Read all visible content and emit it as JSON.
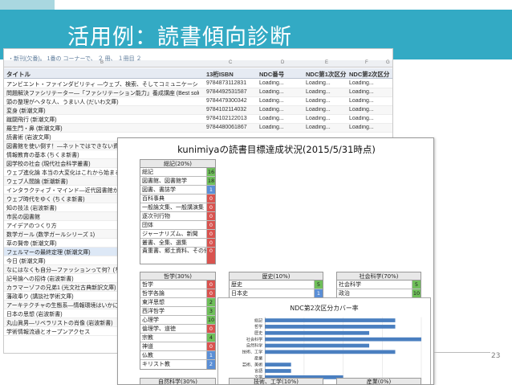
{
  "slide": {
    "title": "活用例：読書傾向診断",
    "page_number": "23"
  },
  "sheet": {
    "formula_text": "・新刊(欠番)。 1番の コーナーで、 ２ 冊、 １冊目 ２",
    "col_letters": [
      "B",
      "C",
      "D",
      "E",
      "F",
      "G"
    ],
    "headers": {
      "title": "タイトル",
      "isbn": "13桁ISBN",
      "ndc": "NDC番号",
      "ndc2a": "NDC第1次区分",
      "ndc2b": "NDC第2次区分"
    },
    "rows": [
      {
        "title": "アンビエント・ファインダビリティ ―ウェブ、検索、そしてコミュニケーションをめぐる旅",
        "isbn": "9784873112831",
        "ndc": "Loading...",
        "f": "Loading...",
        "g": "Loading..."
      },
      {
        "title": "問題解決ファシリテーター―「ファシリテーション能力」養成講座 (Best solution)",
        "isbn": "9784492531587",
        "ndc": "Loading...",
        "f": "Loading...",
        "g": "Loading..."
      },
      {
        "title": "頭の整理がヘタな人、うまい人 (だいわ文庫)",
        "isbn": "9784479300342",
        "ndc": "Loading...",
        "f": "Loading...",
        "g": "Loading..."
      },
      {
        "title": "変身 (新潮文庫)",
        "isbn": "9784102114032",
        "ndc": "Loading...",
        "f": "Loading...",
        "g": "Loading..."
      },
      {
        "title": "蹴闘飛行 (新潮文庫)",
        "isbn": "9784102122013",
        "ndc": "Loading...",
        "f": "Loading...",
        "g": "Loading..."
      },
      {
        "title": "羅生門・鼻 (新潮文庫)",
        "isbn": "9784480061867",
        "ndc": "Loading...",
        "f": "Loading...",
        "g": "Loading..."
      },
      {
        "title": "読書術 (岩波文庫)",
        "isbn": "",
        "ndc": "",
        "f": "",
        "g": ""
      },
      {
        "title": "図書館を使い倒す！―ネットではできない資料",
        "isbn": "",
        "ndc": "",
        "f": "",
        "g": ""
      },
      {
        "title": "情報教育の基本 (ちくま新書)",
        "isbn": "",
        "ndc": "",
        "f": "",
        "g": ""
      },
      {
        "title": "図学校の社会 (現代社会科学叢書)",
        "isbn": "",
        "ndc": "",
        "f": "",
        "g": ""
      },
      {
        "title": "ウェブ進化論 本当の大変化はこれから始まる",
        "isbn": "",
        "ndc": "",
        "f": "",
        "g": ""
      },
      {
        "title": "ウェブ人間論 (新潮新書)",
        "isbn": "",
        "ndc": "",
        "f": "",
        "g": ""
      },
      {
        "title": "インタラクティブ・マインド―近代図書館から",
        "isbn": "",
        "ndc": "",
        "f": "",
        "g": ""
      },
      {
        "title": "ウェブ時代をゆく (ちくま新書)",
        "isbn": "",
        "ndc": "",
        "f": "",
        "g": ""
      },
      {
        "title": "知の技法 (岩波新書)",
        "isbn": "",
        "ndc": "",
        "f": "",
        "g": ""
      },
      {
        "title": "市民の図書館",
        "isbn": "",
        "ndc": "",
        "f": "",
        "g": ""
      },
      {
        "title": "アイデアのつくり方",
        "isbn": "",
        "ndc": "",
        "f": "",
        "g": ""
      },
      {
        "title": "数学ガール (数学ガールシリーズ 1)",
        "isbn": "",
        "ndc": "",
        "f": "",
        "g": ""
      },
      {
        "title": "草の賢帝 (新潮文庫)",
        "isbn": "",
        "ndc": "",
        "f": "",
        "g": ""
      },
      {
        "title": "フェルマーの最終定理 (新潮文庫)",
        "isbn": "",
        "ndc": "",
        "f": "",
        "g": ""
      },
      {
        "title": "今日 (新潮文庫)",
        "isbn": "",
        "ndc": "",
        "f": "",
        "g": ""
      },
      {
        "title": "なにはなくも自分―ファッションって何？(ちくま",
        "isbn": "",
        "ndc": "",
        "f": "",
        "g": ""
      },
      {
        "title": "記号論への招待 (岩波新書)",
        "isbn": "",
        "ndc": "",
        "f": "",
        "g": ""
      },
      {
        "title": "カラマーゾフの兄弟1 (光文社古典新訳文庫)",
        "isbn": "",
        "ndc": "",
        "f": "",
        "g": ""
      },
      {
        "title": "藩政奉り (講談社学術文庫)",
        "isbn": "",
        "ndc": "",
        "f": "",
        "g": ""
      },
      {
        "title": "アーキテクチャの生態系―情報環境はいかに",
        "isbn": "",
        "ndc": "",
        "f": "",
        "g": ""
      },
      {
        "title": "日本の思想 (岩波新書)",
        "isbn": "",
        "ndc": "",
        "f": "",
        "g": ""
      },
      {
        "title": "丸山眞男―リベラリストの肖像 (岩波新書)",
        "isbn": "",
        "ndc": "",
        "f": "",
        "g": ""
      },
      {
        "title": "学術情報流通とオープンアクセス",
        "isbn": "",
        "ndc": "",
        "f": "",
        "g": ""
      }
    ]
  },
  "report": {
    "title": "kunimiyaの読書目標達成状況(2015/5/31時点)",
    "tables": [
      {
        "caption": "総記(20%)",
        "rows": [
          {
            "name": "総記",
            "value": "16",
            "color": "green"
          },
          {
            "name": "図書館、図書館学",
            "value": "18",
            "color": "green"
          },
          {
            "name": "図書、書誌学",
            "value": "1",
            "color": "blue"
          },
          {
            "name": "百科事典",
            "value": "0",
            "color": "red"
          },
          {
            "name": "一般論文集、一般講演集",
            "value": "0",
            "color": "red"
          },
          {
            "name": "逐次刊行物",
            "value": "0",
            "color": "red"
          },
          {
            "name": "団体",
            "value": "0",
            "color": "red"
          },
          {
            "name": "ジャーナリズム、新聞",
            "value": "0",
            "color": "red"
          },
          {
            "name": "叢書、全集、選集",
            "value": "0",
            "color": "red"
          },
          {
            "name": "貴重書、郷土資料、その他の特別コレクション",
            "value": "0",
            "color": "red",
            "tall": true
          }
        ]
      },
      {
        "caption": "哲学(30%)",
        "rows": [
          {
            "name": "哲学",
            "value": "0",
            "color": "red"
          },
          {
            "name": "哲学各論",
            "value": "0",
            "color": "red"
          },
          {
            "name": "東洋思想",
            "value": "2",
            "color": "green"
          },
          {
            "name": "西洋哲学",
            "value": "3",
            "color": "green"
          },
          {
            "name": "心理学",
            "value": "10",
            "color": "green"
          },
          {
            "name": "倫理学、道徳",
            "value": "0",
            "color": "red"
          },
          {
            "name": "宗教",
            "value": "4",
            "color": "green"
          },
          {
            "name": "神道",
            "value": "0",
            "color": "red"
          },
          {
            "name": "仏教",
            "value": "1",
            "color": "blue"
          },
          {
            "name": "キリスト教",
            "value": "2",
            "color": "blue"
          }
        ]
      },
      {
        "caption": "歴史(10%)",
        "rows": [
          {
            "name": "歴史",
            "value": "5",
            "color": "green"
          },
          {
            "name": "日本史",
            "value": "1",
            "color": "blue"
          },
          {
            "name": "アジア史、東洋史",
            "value": "2",
            "color": "blue"
          },
          {
            "name": "ヨーロッパ史、西洋史",
            "value": "1",
            "color": "blue"
          },
          {
            "name": "アフリカ史",
            "value": "0",
            "color": "red"
          },
          {
            "name": "北アフリカ史",
            "value": "0",
            "color": "red"
          },
          {
            "name": "南アフリカ史",
            "value": "0",
            "color": "red"
          },
          {
            "name": "オセアニア史、南極地方史",
            "value": "0",
            "color": "red"
          },
          {
            "name": "伝記",
            "value": "0",
            "color": "red"
          },
          {
            "name": "地理、地誌、紀行",
            "value": "2",
            "color": "blue"
          }
        ]
      },
      {
        "caption": "社会科学(70%)",
        "rows": [
          {
            "name": "社会科学",
            "value": "5",
            "color": "green"
          },
          {
            "name": "政治",
            "value": "10",
            "color": "green"
          },
          {
            "name": "法律",
            "value": "6",
            "color": "green"
          },
          {
            "name": "経済",
            "value": "9",
            "color": "green"
          },
          {
            "name": "財政",
            "value": "0",
            "color": "red"
          },
          {
            "name": "統計",
            "value": "0",
            "color": "red"
          },
          {
            "name": "社会",
            "value": "10",
            "color": "green"
          },
          {
            "name": "教育",
            "value": "5",
            "color": "green"
          },
          {
            "name": "風俗習慣、民俗学、民族学",
            "value": "5",
            "color": "green"
          },
          {
            "name": "国防、軍事",
            "value": "3",
            "color": "green"
          }
        ]
      }
    ],
    "bottom_captions": [
      "自然科学(30%)",
      "技術、工学(10%)",
      "産業(0%)"
    ]
  },
  "chart_data": {
    "type": "bar",
    "orientation": "horizontal",
    "title": "NDC第2次区分カバー率",
    "categories": [
      "総記",
      "哲学",
      "歴史",
      "社会科学",
      "自然科学",
      "技術、工学",
      "産業",
      "芸術、美術",
      "言語",
      "文学"
    ],
    "values": [
      50,
      50,
      40,
      60,
      40,
      50,
      0,
      10,
      10,
      30
    ],
    "xticks": [
      "0.00%",
      "15.00%",
      "30.00%",
      "45.00%",
      "60.00%"
    ],
    "xlim": [
      0,
      60
    ],
    "bar_color": "#4a7fc0",
    "grid": true
  }
}
